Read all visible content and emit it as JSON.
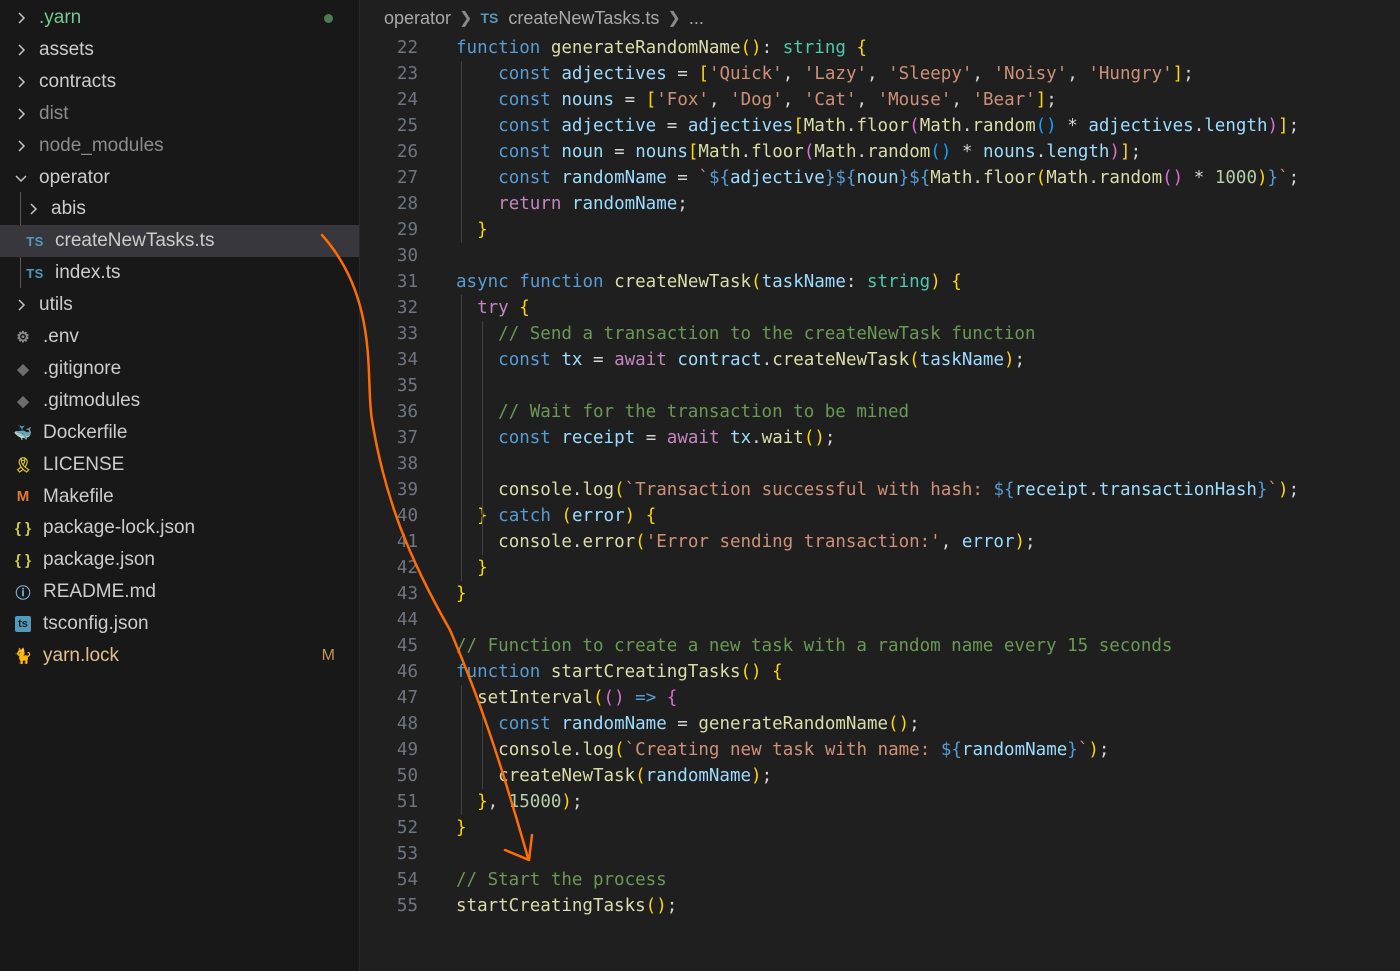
{
  "explorer": {
    "items": [
      {
        "label": ".yarn",
        "kind": "folder",
        "expanded": false,
        "icon": "chevron-right-icon",
        "color": "#73c991",
        "status": "dot"
      },
      {
        "label": "assets",
        "kind": "folder",
        "expanded": false,
        "icon": "chevron-right-icon",
        "color": "#cccccc"
      },
      {
        "label": "contracts",
        "kind": "folder",
        "expanded": false,
        "icon": "chevron-right-icon",
        "color": "#cccccc"
      },
      {
        "label": "dist",
        "kind": "folder",
        "expanded": false,
        "icon": "chevron-right-icon",
        "color": "#8c8c8c"
      },
      {
        "label": "node_modules",
        "kind": "folder",
        "expanded": false,
        "icon": "chevron-right-icon",
        "color": "#8c8c8c"
      },
      {
        "label": "operator",
        "kind": "folder",
        "expanded": true,
        "icon": "chevron-down-icon",
        "color": "#cccccc"
      },
      {
        "label": "abis",
        "kind": "folder",
        "expanded": false,
        "icon": "chevron-right-icon",
        "color": "#cccccc"
      },
      {
        "label": "createNewTasks.ts",
        "kind": "file",
        "icon": "typescript-icon",
        "icon_text": "TS",
        "color": "#cccccc",
        "selected": true
      },
      {
        "label": "index.ts",
        "kind": "file",
        "icon": "typescript-icon",
        "icon_text": "TS",
        "color": "#cccccc"
      },
      {
        "label": "utils",
        "kind": "folder",
        "expanded": false,
        "icon": "chevron-right-icon",
        "color": "#cccccc"
      },
      {
        "label": ".env",
        "kind": "file",
        "icon": "gear-icon",
        "icon_text": "⚙",
        "color": "#cccccc"
      },
      {
        "label": ".gitignore",
        "kind": "file",
        "icon": "git-icon",
        "icon_text": "◆",
        "color": "#cccccc"
      },
      {
        "label": ".gitmodules",
        "kind": "file",
        "icon": "git-icon",
        "icon_text": "◆",
        "color": "#cccccc"
      },
      {
        "label": "Dockerfile",
        "kind": "file",
        "icon": "docker-icon",
        "icon_text": "🐳",
        "color": "#cccccc"
      },
      {
        "label": "LICENSE",
        "kind": "file",
        "icon": "license-icon",
        "icon_text": "🎗",
        "color": "#cccccc"
      },
      {
        "label": "Makefile",
        "kind": "file",
        "icon": "makefile-icon",
        "icon_text": "M",
        "color": "#cccccc"
      },
      {
        "label": "package-lock.json",
        "kind": "file",
        "icon": "json-icon",
        "icon_text": "{ }",
        "color": "#cccccc"
      },
      {
        "label": "package.json",
        "kind": "file",
        "icon": "json-icon",
        "icon_text": "{ }",
        "color": "#cccccc"
      },
      {
        "label": "README.md",
        "kind": "file",
        "icon": "info-icon",
        "icon_text": "ⓘ",
        "color": "#cccccc"
      },
      {
        "label": "tsconfig.json",
        "kind": "file",
        "icon": "tsconfig-icon",
        "icon_text": "ts",
        "color": "#cccccc"
      },
      {
        "label": "yarn.lock",
        "kind": "file",
        "icon": "yarn-icon",
        "icon_text": "🐈",
        "color": "#e2c08d",
        "badge": "M"
      }
    ]
  },
  "breadcrumb": {
    "folder": "operator",
    "file_badge": "TS",
    "file": "createNewTasks.ts",
    "more": "..."
  },
  "editor": {
    "lines": [
      {
        "num": "22",
        "text": "function generateRandomName(): string {"
      },
      {
        "num": "23",
        "text": "    const adjectives = ['Quick', 'Lazy', 'Sleepy', 'Noisy', 'Hungry'];"
      },
      {
        "num": "24",
        "text": "    const nouns = ['Fox', 'Dog', 'Cat', 'Mouse', 'Bear'];"
      },
      {
        "num": "25",
        "text": "    const adjective = adjectives[Math.floor(Math.random() * adjectives.length)];"
      },
      {
        "num": "26",
        "text": "    const noun = nouns[Math.floor(Math.random() * nouns.length)];"
      },
      {
        "num": "27",
        "text": "    const randomName = `${adjective}${noun}${Math.floor(Math.random() * 1000)}`;"
      },
      {
        "num": "28",
        "text": "    return randomName;"
      },
      {
        "num": "29",
        "text": "  }"
      },
      {
        "num": "30",
        "text": ""
      },
      {
        "num": "31",
        "text": "async function createNewTask(taskName: string) {"
      },
      {
        "num": "32",
        "text": "  try {"
      },
      {
        "num": "33",
        "text": "    // Send a transaction to the createNewTask function"
      },
      {
        "num": "34",
        "text": "    const tx = await contract.createNewTask(taskName);"
      },
      {
        "num": "35",
        "text": ""
      },
      {
        "num": "36",
        "text": "    // Wait for the transaction to be mined"
      },
      {
        "num": "37",
        "text": "    const receipt = await tx.wait();"
      },
      {
        "num": "38",
        "text": ""
      },
      {
        "num": "39",
        "text": "    console.log(`Transaction successful with hash: ${receipt.transactionHash}`);"
      },
      {
        "num": "40",
        "text": "  } catch (error) {"
      },
      {
        "num": "41",
        "text": "    console.error('Error sending transaction:', error);"
      },
      {
        "num": "42",
        "text": "  }"
      },
      {
        "num": "43",
        "text": "}"
      },
      {
        "num": "44",
        "text": ""
      },
      {
        "num": "45",
        "text": "// Function to create a new task with a random name every 15 seconds"
      },
      {
        "num": "46",
        "text": "function startCreatingTasks() {"
      },
      {
        "num": "47",
        "text": "  setInterval(() => {"
      },
      {
        "num": "48",
        "text": "    const randomName = generateRandomName();"
      },
      {
        "num": "49",
        "text": "    console.log(`Creating new task with name: ${randomName}`);"
      },
      {
        "num": "50",
        "text": "    createNewTask(randomName);"
      },
      {
        "num": "51",
        "text": "  }, 15000);"
      },
      {
        "num": "52",
        "text": "}"
      },
      {
        "num": "53",
        "text": ""
      },
      {
        "num": "54",
        "text": "// Start the process"
      },
      {
        "num": "55",
        "text": "startCreatingTasks();"
      }
    ]
  },
  "annotation": {
    "color": "#ff6d00"
  }
}
